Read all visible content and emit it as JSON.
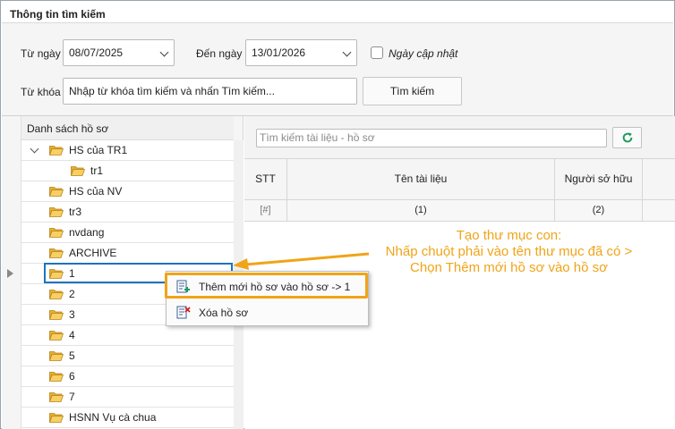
{
  "header": {
    "title": "Thông tin tìm kiếm"
  },
  "search": {
    "from_label": "Từ ngày",
    "from_value": "08/07/2025",
    "to_label": "Đến ngày",
    "to_value": "13/01/2026",
    "update_date_label": "Ngày cập nhật",
    "keyword_label": "Từ khóa",
    "keyword_value": "Nhập từ khóa tìm kiếm và nhấn Tìm kiếm...",
    "search_button": "Tìm kiếm"
  },
  "tree": {
    "header": "Danh sách hồ sơ",
    "items": [
      {
        "label": "HS của TR1",
        "level": 0,
        "expanded": true
      },
      {
        "label": "tr1",
        "level": 1
      },
      {
        "label": "HS của NV",
        "level": 0
      },
      {
        "label": "tr3",
        "level": 0
      },
      {
        "label": "nvdang",
        "level": 0
      },
      {
        "label": "ARCHIVE",
        "level": 0
      },
      {
        "label": "1",
        "level": 0,
        "selected": true
      },
      {
        "label": "2",
        "level": 0
      },
      {
        "label": "3",
        "level": 0
      },
      {
        "label": "4",
        "level": 0
      },
      {
        "label": "5",
        "level": 0
      },
      {
        "label": "6",
        "level": 0
      },
      {
        "label": "7",
        "level": 0
      },
      {
        "label": "HSNN Vụ cà chua",
        "level": 0
      }
    ]
  },
  "documents": {
    "search_placeholder": "Tìm kiếm tài liệu - hồ sơ",
    "columns": [
      "STT",
      "Tên tài liệu",
      "Người sở hữu"
    ],
    "filter_row": [
      "[#]",
      "(1)",
      "(2)"
    ]
  },
  "context_menu": {
    "items": [
      {
        "label": "Thêm mới hồ sơ vào hồ sơ  -> 1",
        "icon": "add-record-icon"
      },
      {
        "label": "Xóa hồ sơ",
        "icon": "delete-record-icon"
      }
    ]
  },
  "annotation": {
    "lines": [
      "Tạo thư mục con:",
      "Nhấp chuột phải vào tên thư mục đã có >",
      "Chọn Thêm mới hồ sơ vào hồ sơ"
    ]
  },
  "colors": {
    "accent_orange": "#f0a418",
    "selection_blue": "#1e73be",
    "folder_yellow": "#f4c24a",
    "refresh_green": "#1a9a5c"
  }
}
